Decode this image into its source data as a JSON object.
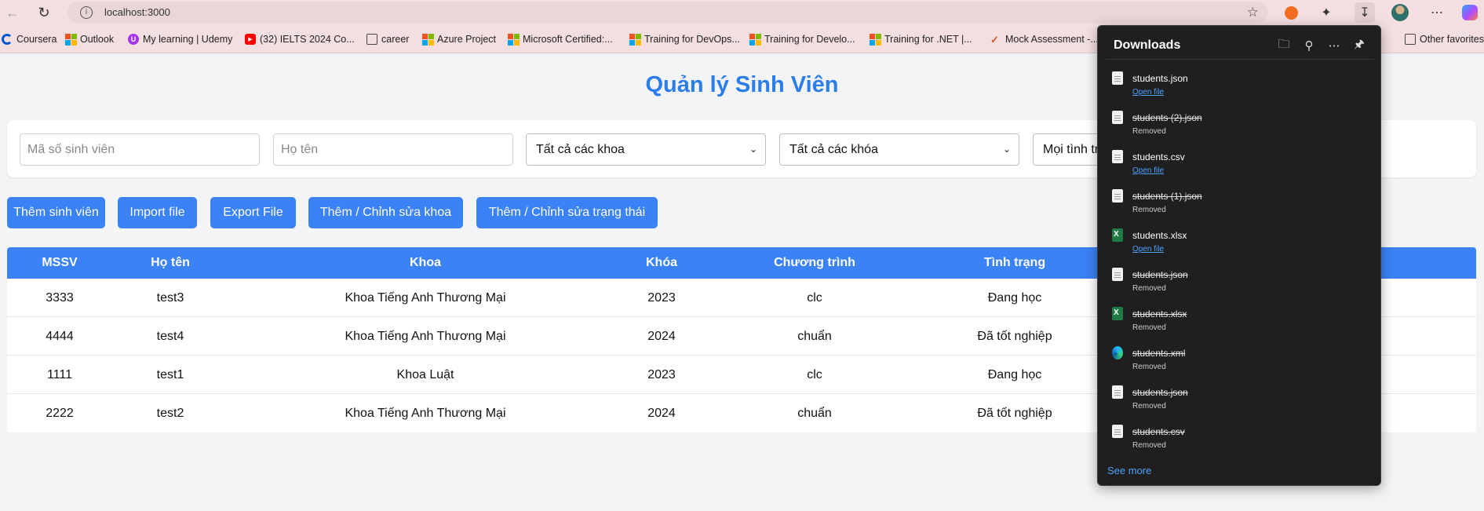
{
  "browser": {
    "url": "localhost:3000",
    "info_icon": "i",
    "favorites": [
      {
        "label": "Coursera",
        "icon": "coursera-icon"
      },
      {
        "label": "Outlook",
        "icon": "microsoft-icon"
      },
      {
        "label": "My learning | Udemy",
        "icon": "udemy-icon"
      },
      {
        "label": "(32) IELTS 2024 Co...",
        "icon": "youtube-icon"
      },
      {
        "label": "career",
        "icon": "folder-icon"
      },
      {
        "label": "Azure Project",
        "icon": "microsoft-icon"
      },
      {
        "label": "Microsoft Certified:...",
        "icon": "microsoft-icon"
      },
      {
        "label": "Training for DevOps...",
        "icon": "microsoft-icon"
      },
      {
        "label": "Training for Develo...",
        "icon": "microsoft-icon"
      },
      {
        "label": "Training for .NET |...",
        "icon": "microsoft-icon"
      },
      {
        "label": "Mock Assessment -...",
        "icon": "mock-icon"
      },
      {
        "label": "Other favorites",
        "icon": "folder-icon"
      }
    ]
  },
  "page": {
    "title": "Quản lý Sinh Viên",
    "filters": {
      "student_id_placeholder": "Mã số sinh viên",
      "name_placeholder": "Họ tên",
      "faculty_select": "Tất cả các khoa",
      "course_select": "Tất cả các khóa",
      "status_select": "Mọi tình trạng"
    },
    "buttons": {
      "add_student": "Thêm sinh viên",
      "import": "Import file",
      "export": "Export File",
      "edit_faculty": "Thêm / Chỉnh sửa khoa",
      "edit_status": "Thêm / Chỉnh sửa trạng thái"
    },
    "table": {
      "headers": [
        "MSSV",
        "Họ tên",
        "Khoa",
        "Khóa",
        "Chương trình",
        "Tình trạng"
      ],
      "rows": [
        [
          "3333",
          "test3",
          "Khoa Tiếng Anh Thương Mại",
          "2023",
          "clc",
          "Đang học"
        ],
        [
          "4444",
          "test4",
          "Khoa Tiếng Anh Thương Mại",
          "2024",
          "chuẩn",
          "Đã tốt nghiệp"
        ],
        [
          "1111",
          "test1",
          "Khoa Luật",
          "2023",
          "clc",
          "Đang học"
        ],
        [
          "2222",
          "test2",
          "Khoa Tiếng Anh Thương Mại",
          "2024",
          "chuẩn",
          "Đã tốt nghiệp"
        ]
      ]
    }
  },
  "downloads": {
    "title": "Downloads",
    "see_more": "See more",
    "items": [
      {
        "name": "students.json",
        "status": "Open file",
        "removed": false,
        "type": "doc"
      },
      {
        "name": "students (2).json",
        "status": "Removed",
        "removed": true,
        "type": "doc"
      },
      {
        "name": "students.csv",
        "status": "Open file",
        "removed": false,
        "type": "doc"
      },
      {
        "name": "students (1).json",
        "status": "Removed",
        "removed": true,
        "type": "doc"
      },
      {
        "name": "students.xlsx",
        "status": "Open file",
        "removed": false,
        "type": "xlsx"
      },
      {
        "name": "students.json",
        "status": "Removed",
        "removed": true,
        "type": "doc"
      },
      {
        "name": "students.xlsx",
        "status": "Removed",
        "removed": true,
        "type": "xlsx"
      },
      {
        "name": "students.xml",
        "status": "Removed",
        "removed": true,
        "type": "edge"
      },
      {
        "name": "students.json",
        "status": "Removed",
        "removed": true,
        "type": "doc"
      },
      {
        "name": "students.csv",
        "status": "Removed",
        "removed": true,
        "type": "doc"
      }
    ]
  },
  "colors": {
    "accent": "#3b82f6",
    "title": "#2b7de9",
    "chrome": "#f3dfe0",
    "panel": "#1f1f1f"
  }
}
